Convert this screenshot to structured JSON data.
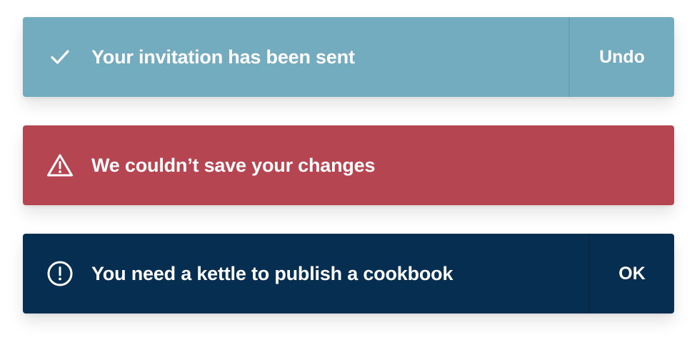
{
  "toasts": [
    {
      "id": "success",
      "type": "success",
      "icon": "check-icon",
      "message": "Your invitation has been sent",
      "action_label": "Undo",
      "background": "#73abbf"
    },
    {
      "id": "error",
      "type": "error",
      "icon": "warning-triangle-icon",
      "message": "We couldn’t save your changes",
      "background": "#b64552"
    },
    {
      "id": "info",
      "type": "info",
      "icon": "exclamation-circle-icon",
      "message": "You need a kettle to publish a cookbook",
      "action_label": "OK",
      "background": "#062e50"
    }
  ]
}
